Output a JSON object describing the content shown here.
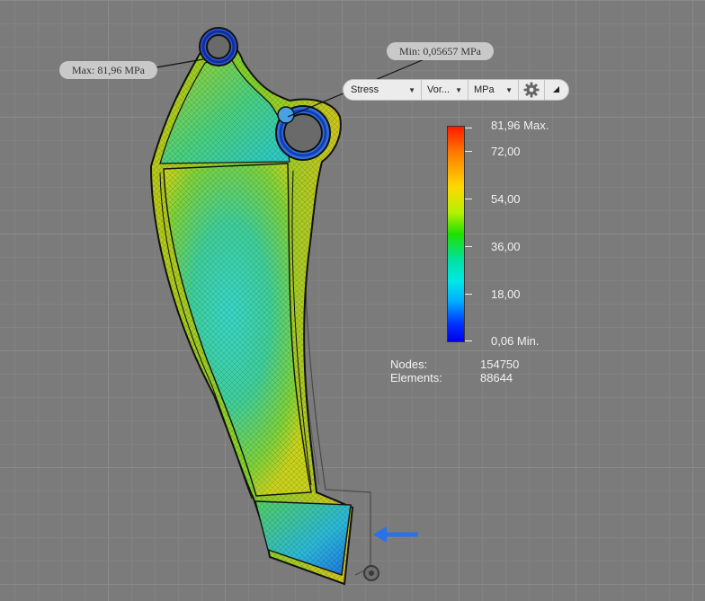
{
  "callouts": {
    "max_label": "Max: 81,96 MPa",
    "min_label": "Min: 0,05657 MPa"
  },
  "toolbar": {
    "result_type": "Stress",
    "component": "Vor...",
    "unit": "MPa",
    "settings_icon": "gear-icon",
    "collapse_icon": "triangle-icon"
  },
  "legend": {
    "labels": [
      "81,96 Max.",
      "72,00",
      "54,00",
      "36,00",
      "18,00",
      "0,06 Min."
    ],
    "colors": {
      "max": "#ff1a00",
      "min": "#0000ee"
    }
  },
  "mesh_stats": {
    "nodes_label": "Nodes:",
    "nodes_value": "154750",
    "elements_label": "Elements:",
    "elements_value": "88644"
  },
  "load_arrow_icon": "arrow-left-icon",
  "origin_icon": "constraint-icon"
}
